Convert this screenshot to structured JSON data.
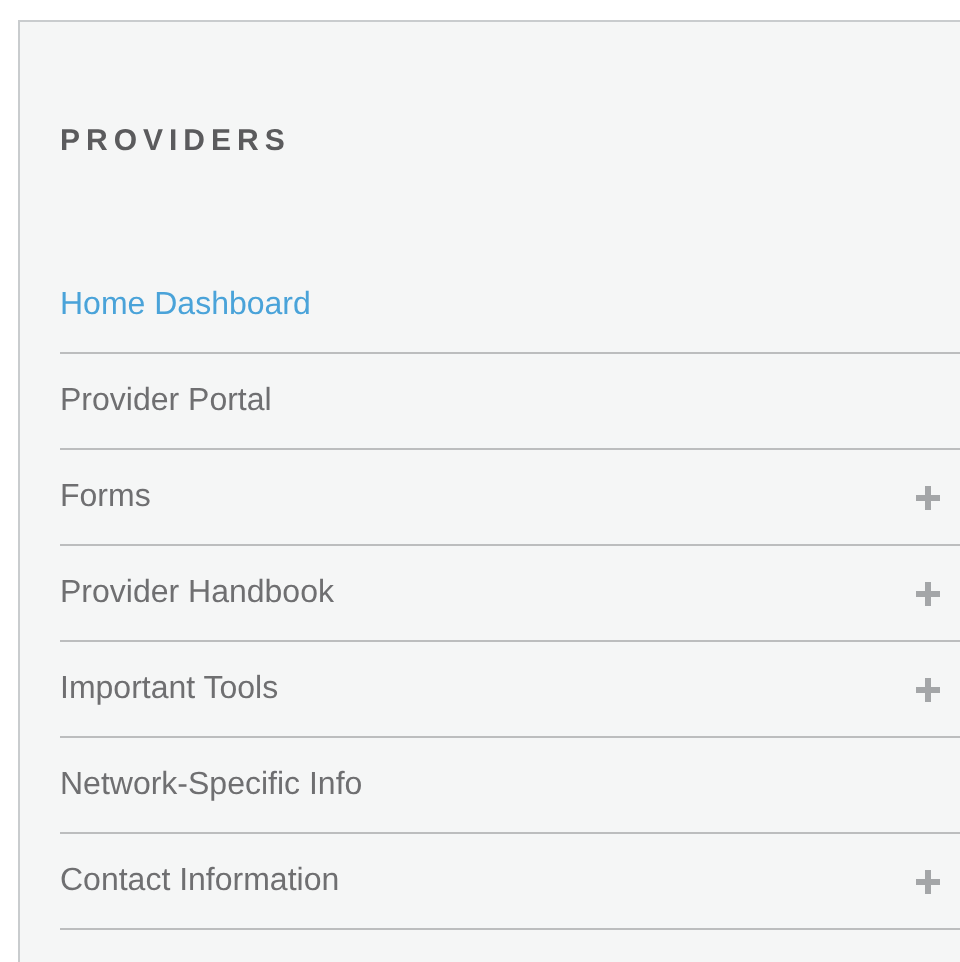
{
  "panel": {
    "heading": "PROVIDERS",
    "items": [
      {
        "label": "Home Dashboard",
        "selected": true,
        "expandable": false
      },
      {
        "label": "Provider Portal",
        "selected": false,
        "expandable": false
      },
      {
        "label": "Forms",
        "selected": false,
        "expandable": true
      },
      {
        "label": "Provider Handbook",
        "selected": false,
        "expandable": true
      },
      {
        "label": "Important Tools",
        "selected": false,
        "expandable": true
      },
      {
        "label": "Network-Specific Info",
        "selected": false,
        "expandable": false
      },
      {
        "label": "Contact Information",
        "selected": false,
        "expandable": true
      }
    ]
  }
}
